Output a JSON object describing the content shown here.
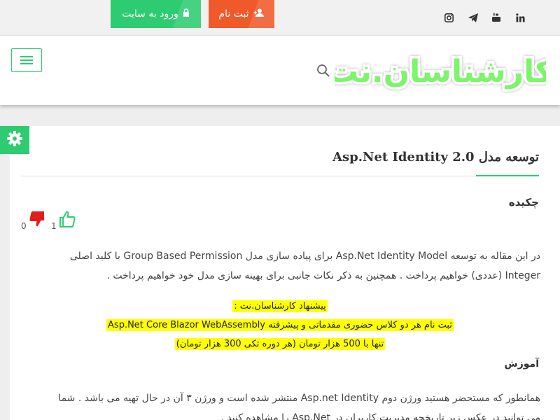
{
  "topbar": {
    "login_label": "ورود به سایت",
    "register_label": "ثبت نام",
    "social_icons": [
      "instagram-icon",
      "telegram-icon",
      "youtube-icon",
      "linkedin-icon"
    ],
    "colors": {
      "login": "#2ecc71",
      "register": "#f0592a"
    }
  },
  "header": {
    "logo_text": "کارشناسان.نت",
    "logo_color": "#7cf56a"
  },
  "article": {
    "title": "توسعه مدل Asp.Net Identity 2.0",
    "abstract_heading": "چکیده",
    "likes": "1",
    "dislikes": "0",
    "abstract_line1": "در این مقاله به توسعه Asp.Net Identity Model برای پیاده سازی مدل Group Based Permission با کلید اصلی",
    "abstract_line2": "Integer (عددی) خواهیم پرداخت . همچنین به ذکر نکات جانبی برای بهینه سازی مدل خود خواهیم پرداخت .",
    "promo_line1": "پیشنهاد کارشناسان.نت :",
    "promo_line2": "ثبت نام هر دو کلاس حضوری مقدماتی و پیشرفته Asp.Net Core Blazor WebAssembly",
    "promo_line3": "تنها با 500 هزار تومان (هر دوره تکی 300 هزار تومان)",
    "section_heading": "آموزش",
    "section_line1": "همانطور که مستحضر هستید ورژن دوم Asp.net Identity منتشر شده است و ورژن ۳ آن در حال تهیه می باشد . شما",
    "section_line2": "می توانید در عکس زیر تاریخچه مدیریت کاربران در Asp.Net را مشاهده کنید ."
  }
}
